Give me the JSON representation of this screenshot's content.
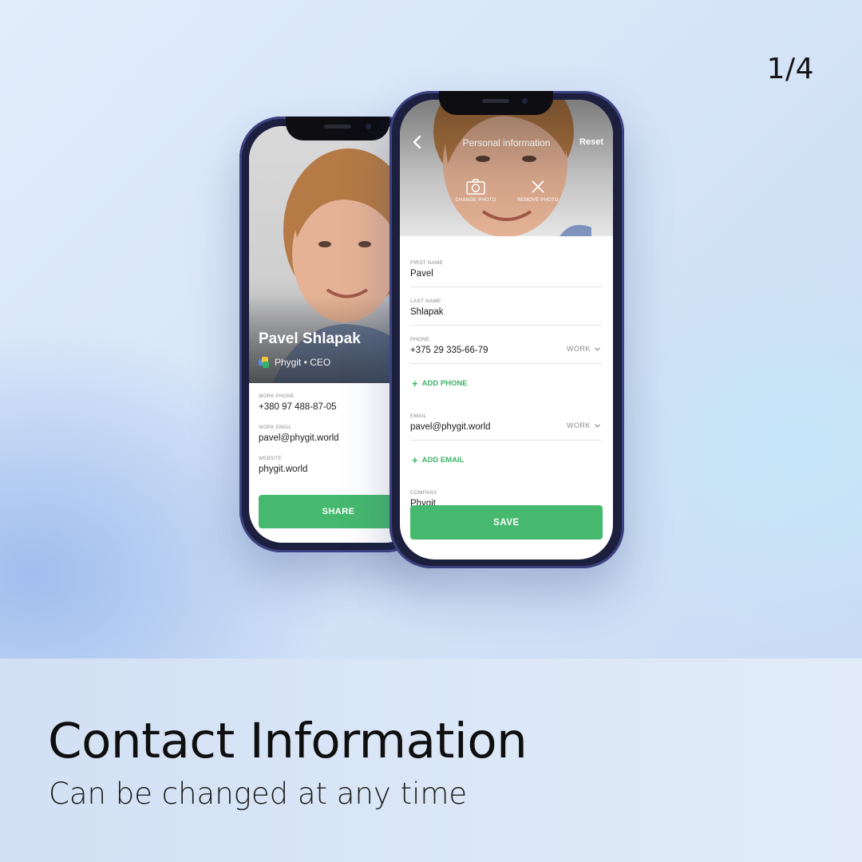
{
  "slide": {
    "counter": "1/4",
    "headline": "Contact Information",
    "subline": "Can be changed at any time"
  },
  "profile_card": {
    "name": "Pavel Shlapak",
    "company_line": "Phygit • CEO",
    "fields": [
      {
        "label": "WORK PHONE",
        "value": "+380 97 488-87-05"
      },
      {
        "label": "WORK EMAIL",
        "value": "pavel@phygit.world"
      },
      {
        "label": "WEBSITE",
        "value": "phygit.world"
      }
    ],
    "share_label": "SHARE"
  },
  "edit_screen": {
    "title": "Personal information",
    "reset_label": "Reset",
    "change_photo_label": "CHANGE PHOTO",
    "remove_photo_label": "REMOVE PHOTO",
    "first_name": {
      "label": "FIRST NAME",
      "value": "Pavel"
    },
    "last_name": {
      "label": "LAST NAME",
      "value": "Shlapak"
    },
    "phone": {
      "label": "PHONE",
      "value": "+375 29 335-66-79",
      "type": "WORK"
    },
    "add_phone_label": "ADD PHONE",
    "email": {
      "label": "EMAIL",
      "value": "pavel@phygit.world",
      "type": "WORK"
    },
    "add_email_label": "ADD EMAIL",
    "company": {
      "label": "COMPANY",
      "value": "Phygit"
    },
    "save_label": "SAVE"
  },
  "colors": {
    "accent_green": "#47b96f",
    "phone_frame": "#1c1f3e"
  },
  "icons": [
    "back-chevron-icon",
    "camera-icon",
    "close-icon",
    "chevron-down-icon",
    "plus-icon",
    "phygit-logo-icon"
  ]
}
